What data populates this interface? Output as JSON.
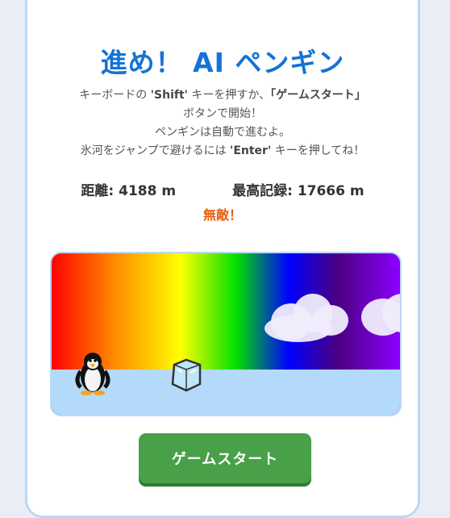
{
  "game": {
    "title": "進め！ AI ペンギン",
    "instructions": {
      "line1_prefix": "キーボードの ",
      "line1_key": "'Shift'",
      "line1_mid": " キーを押すか、",
      "line1_button": "「ゲームスタート」",
      "line1_suffix": "ボタンで開始！",
      "line2": "ペンギンは自動で進むよ。",
      "line3_prefix": "氷河をジャンプで避けるには ",
      "line3_key": "'Enter'",
      "line3_suffix": " キーを押してね！"
    },
    "stats": {
      "distance_label": "距離:",
      "distance_value": "4188",
      "distance_unit": "m",
      "record_label": "最高記録:",
      "record_value": "17666",
      "record_unit": "m"
    },
    "status": "無敵！",
    "start_button_label": "ゲームスタート"
  },
  "scene": {
    "sky": "rainbow-gradient",
    "ground_color": "#b3d9fb",
    "sprites": [
      "penguin-icon",
      "ice-block-icon",
      "cloud-icon",
      "cloud-icon"
    ]
  },
  "colors": {
    "title": "#1473d6",
    "status": "#e85d0c",
    "button": "#48a049"
  }
}
